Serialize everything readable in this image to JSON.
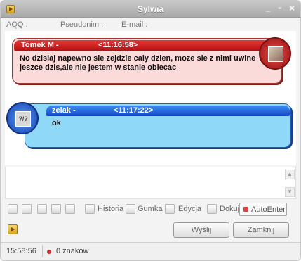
{
  "window": {
    "title": "Sylwia",
    "controls": {
      "minimize": "_",
      "maximize": "▫",
      "close": "×"
    }
  },
  "info_bar": {
    "aqq_label": "AQQ :",
    "nick_label": "Pseudonim :",
    "email_label": "E-mail :"
  },
  "messages": [
    {
      "sender": "Tomek M -",
      "time": "<11:16:58>",
      "text": "No dzisiaj napewno sie zejdzie caly dzien, moze sie z nimi uwine jeszce dzis,ale nie jestem w stanie obiecac",
      "color": "#d91a1a"
    },
    {
      "sender": "zelak -",
      "time": "<11:17:22>",
      "text": "ok",
      "color": "#1a5ad9"
    }
  ],
  "avatars": {
    "contact_icon": "photo-icon",
    "user_icon": "unknown-user-icon",
    "user_placeholder": "?/?"
  },
  "toolbar": {
    "icons": [
      "emoticon-icon",
      "send-file-icon",
      "image-icon",
      "play-icon",
      "page-icon"
    ],
    "historia_label": "Historia",
    "gumka_label": "Gumka",
    "edycja_label": "Edycja",
    "dokuj_label": "Dokuj",
    "autoenter_label": "AutoEnter"
  },
  "actions": {
    "send_label": "Wyślij",
    "close_label": "Zamknij"
  },
  "status": {
    "clock": "15:58:56",
    "chars": "0 znaków"
  }
}
